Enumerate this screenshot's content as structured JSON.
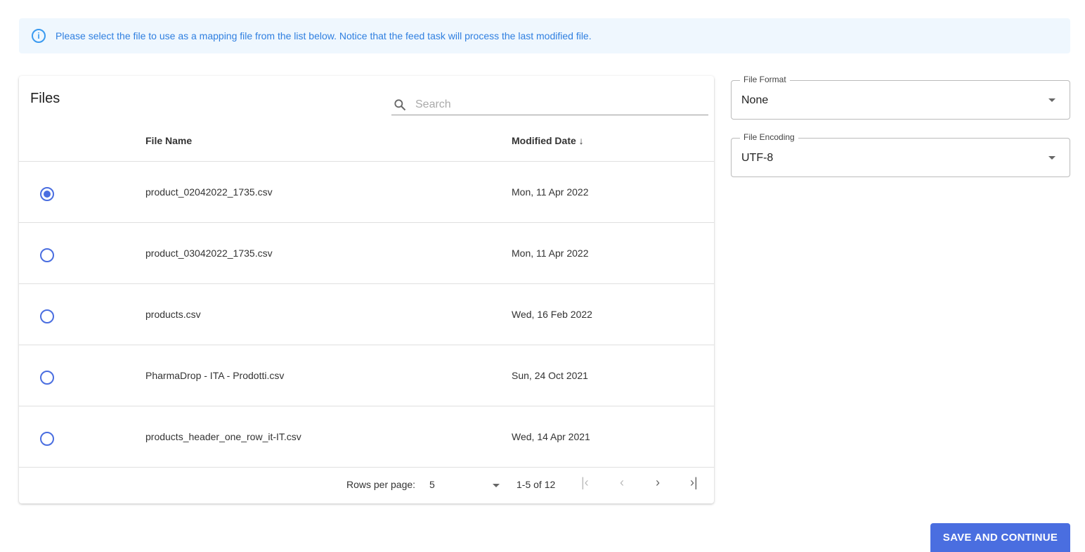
{
  "banner": {
    "text": "Please select the file to use as a mapping file from the list below. Notice that the feed task will process the last modified file."
  },
  "files": {
    "title": "Files",
    "search_placeholder": "Search",
    "col_name": "File Name",
    "col_date": "Modified Date",
    "rows": [
      {
        "name": "product_02042022_1735.csv",
        "date": "Mon, 11 Apr 2022",
        "selected": true
      },
      {
        "name": "product_03042022_1735.csv",
        "date": "Mon, 11 Apr 2022",
        "selected": false
      },
      {
        "name": "products.csv",
        "date": "Wed, 16 Feb 2022",
        "selected": false
      },
      {
        "name": "PharmaDrop - ITA - Prodotti.csv",
        "date": "Sun, 24 Oct 2021",
        "selected": false
      },
      {
        "name": "products_header_one_row_it-IT.csv",
        "date": "Wed, 14 Apr 2021",
        "selected": false
      }
    ],
    "rows_per_page_label": "Rows per page:",
    "rows_per_page": "5",
    "range": "1-5 of 12"
  },
  "format": {
    "label": "File Format",
    "value": "None"
  },
  "encoding": {
    "label": "File Encoding",
    "value": "UTF-8"
  },
  "save_label": "SAVE AND CONTINUE"
}
